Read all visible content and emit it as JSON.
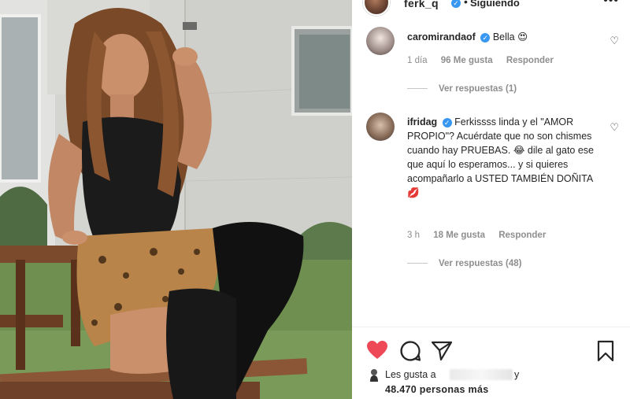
{
  "header": {
    "username": "ferk_q",
    "follow_status": "Siguiendo",
    "separator": "•",
    "more": "•••"
  },
  "comments": [
    {
      "username": "caromirandaof",
      "text": "Bella",
      "emoji": "😍",
      "time": "1 día",
      "likes": "96 Me gusta",
      "reply": "Responder",
      "view_replies": "Ver respuestas (1)"
    },
    {
      "username": "ifridag",
      "text": "Ferkissss linda y el \"AMOR PROPIO\"? Acuérdate que no son chismes cuando hay PRUEBAS.",
      "emoji": "😂",
      "text2": "dile al gato ese que aquí lo esperamos... y si quieres acompañarlo a USTED TAMBIÉN DOÑITA",
      "emoji2": "💋",
      "time": "3 h",
      "likes": "18 Me gusta",
      "reply": "Responder",
      "view_replies": "Ver respuestas (48)"
    }
  ],
  "likes": {
    "line1": "Les gusta a",
    "line1_end": "y",
    "line2": "48.470 personas más"
  },
  "colors": {
    "heart_liked": "#ed4956",
    "text": "#262626",
    "muted": "#8e8e8e",
    "verified": "#3897f0"
  },
  "icons": [
    "heart-filled-icon",
    "comment-icon",
    "share-icon",
    "bookmark-icon",
    "verified-icon",
    "heart-outline-icon",
    "more-icon"
  ]
}
